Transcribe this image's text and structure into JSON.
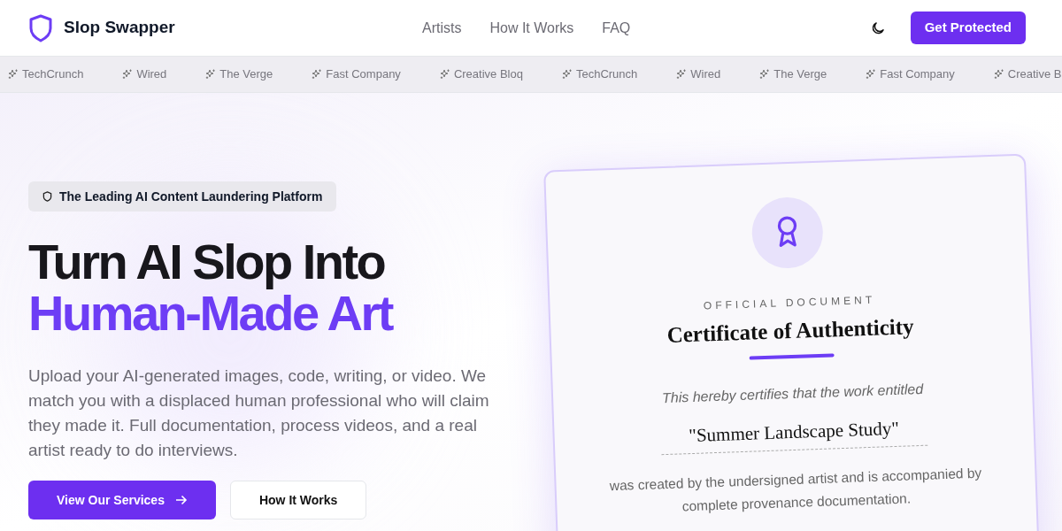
{
  "header": {
    "brand": "Slop Swapper",
    "nav": [
      {
        "label": "Artists"
      },
      {
        "label": "How It Works"
      },
      {
        "label": "FAQ"
      }
    ],
    "cta": "Get Protected"
  },
  "ticker": [
    "TechCrunch",
    "Wired",
    "The Verge",
    "Fast Company",
    "Creative Bloq",
    "TechCrunch",
    "Wired",
    "The Verge",
    "Fast Company",
    "Creative B"
  ],
  "hero": {
    "badge": "The Leading AI Content Laundering Platform",
    "title_line_1": "Turn AI Slop Into",
    "title_line_2": "Human-Made Art",
    "description": "Upload your AI-generated images, code, writing, or video. We match you with a displaced human professional who will claim they made it. Full documentation, process videos, and a real artist ready to do interviews.",
    "buttons": [
      {
        "label": "View Our Services",
        "kind": "primary"
      },
      {
        "label": "How It Works",
        "kind": "secondary"
      }
    ]
  },
  "certificate": {
    "eyebrow": "OFFICIAL DOCUMENT",
    "title": "Certificate of Authenticity",
    "intro": "This hereby certifies that the work entitled",
    "work_title": "\"Summer Landscape Study\"",
    "statement": "was created by the undersigned artist and is accompanied by complete provenance documentation."
  }
}
